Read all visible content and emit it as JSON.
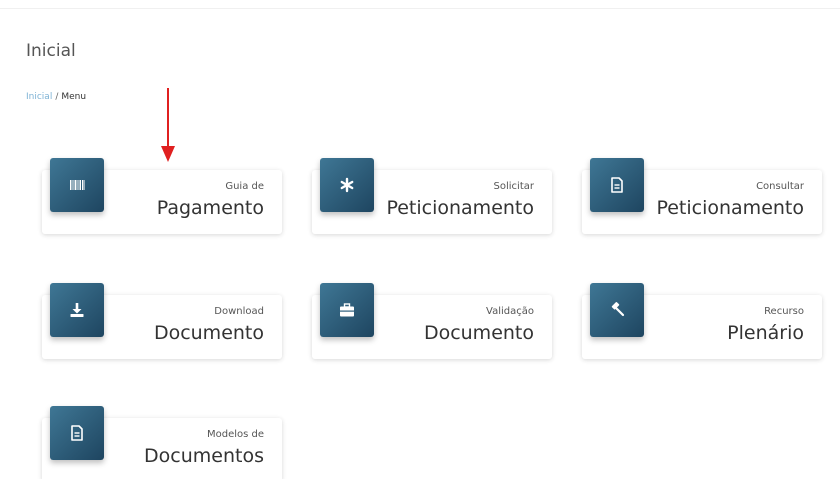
{
  "page": {
    "title": "Inicial"
  },
  "breadcrumb": {
    "home": "Inicial",
    "separator": "/",
    "current": "Menu"
  },
  "cards": [
    {
      "small": "Guia de",
      "big": "Pagamento",
      "icon": "barcode-icon"
    },
    {
      "small": "Solicitar",
      "big": "Peticionamento",
      "icon": "asterisk-icon"
    },
    {
      "small": "Consultar",
      "big": "Peticionamento",
      "icon": "document-icon"
    },
    {
      "small": "Download",
      "big": "Documento",
      "icon": "download-icon"
    },
    {
      "small": "Validação",
      "big": "Documento",
      "icon": "briefcase-icon"
    },
    {
      "small": "Recurso",
      "big": "Plenário",
      "icon": "gavel-icon"
    },
    {
      "small": "Modelos de",
      "big": "Documentos",
      "icon": "document-icon"
    }
  ],
  "colors": {
    "icon_gradient_start": "#3f7795",
    "icon_gradient_end": "#1e4560",
    "breadcrumb_link": "#7fb3d5",
    "arrow": "#e02020"
  }
}
